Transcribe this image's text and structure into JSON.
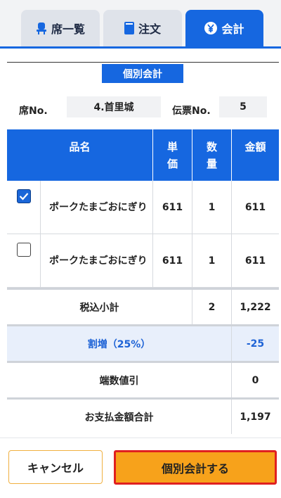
{
  "tabs": [
    {
      "label": "席一覧",
      "icon": "seat-icon",
      "active": false
    },
    {
      "label": "注文",
      "icon": "book-icon",
      "active": false
    },
    {
      "label": "会計",
      "icon": "yen-icon",
      "active": true
    }
  ],
  "title": "個別会計",
  "seat": {
    "label": "席No.",
    "value": "4.首里城"
  },
  "slip": {
    "label": "伝票No.",
    "value": "5"
  },
  "table": {
    "headers": {
      "name": "品名",
      "unit_price": "単価",
      "qty": "数量",
      "amount": "金額"
    },
    "rows": [
      {
        "checked": true,
        "name": "ポークたまごおにぎり",
        "unit_price": "611",
        "qty": "1",
        "amount": "611"
      },
      {
        "checked": false,
        "name": "ポークたまごおにぎり",
        "unit_price": "611",
        "qty": "1",
        "amount": "611"
      }
    ],
    "subtotal": {
      "label": "税込小計",
      "qty": "2",
      "amount": "1,222"
    },
    "surcharge": {
      "label": "割増（25%）",
      "amount": "-25"
    },
    "rounding": {
      "label": "端数値引",
      "amount": "0"
    },
    "total": {
      "label": "お支払金額合計",
      "amount": "1,197"
    }
  },
  "buttons": {
    "cancel": "キャンセル",
    "split_pay": "個別会計する"
  },
  "colors": {
    "primary": "#1667e0",
    "accent": "#f7a21b",
    "highlight_border": "#e02020",
    "surcharge_bg": "#e8effb"
  }
}
